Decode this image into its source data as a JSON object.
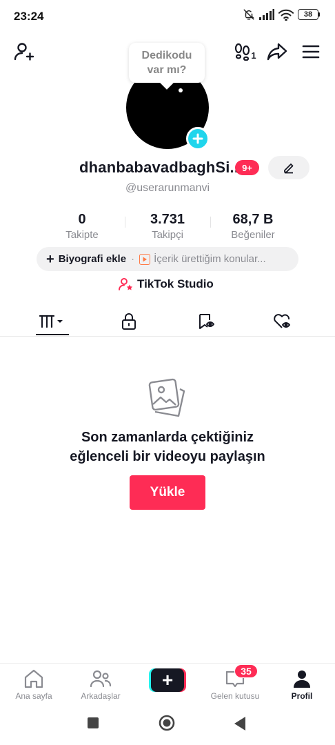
{
  "status_bar": {
    "time": "23:24",
    "battery": "38",
    "icons": [
      "bell-muted-icon",
      "signal-icon",
      "wifi-icon",
      "battery-icon"
    ]
  },
  "header": {
    "tooltip_line1": "Dedikodu",
    "tooltip_line2": "var mı?",
    "footprints_count": "1"
  },
  "profile": {
    "username": "dhanbabavadbaghSi...",
    "notification_badge": "9+",
    "handle": "@userarunmanvi"
  },
  "stats": [
    {
      "value": "0",
      "label": "Takipte"
    },
    {
      "value": "3.731",
      "label": "Takipçi"
    },
    {
      "value": "68,7 B",
      "label": "Beğeniler"
    }
  ],
  "bio": {
    "plus": "+",
    "add_label": "Biyografi ekle",
    "separator": "·",
    "topics_label": "İçerik ürettiğim konular..."
  },
  "studio": {
    "label": "TikTok Studio"
  },
  "tabs": [
    "videos-grid-icon",
    "lock-icon",
    "tagged-icon",
    "liked-icon"
  ],
  "empty_state": {
    "line1": "Son zamanlarda çektiğiniz",
    "line2": "eğlenceli bir videoyu paylaşın",
    "upload_label": "Yükle"
  },
  "bottom_nav": {
    "home": "Ana sayfa",
    "friends": "Arkadaşlar",
    "create": "+",
    "inbox": "Gelen kutusu",
    "inbox_badge": "35",
    "profile": "Profil"
  },
  "colors": {
    "accent": "#fe2c55",
    "cyan": "#25f4ee",
    "avatar_add": "#20d5ec",
    "text_primary": "#161823",
    "text_secondary": "#8a8b91"
  }
}
